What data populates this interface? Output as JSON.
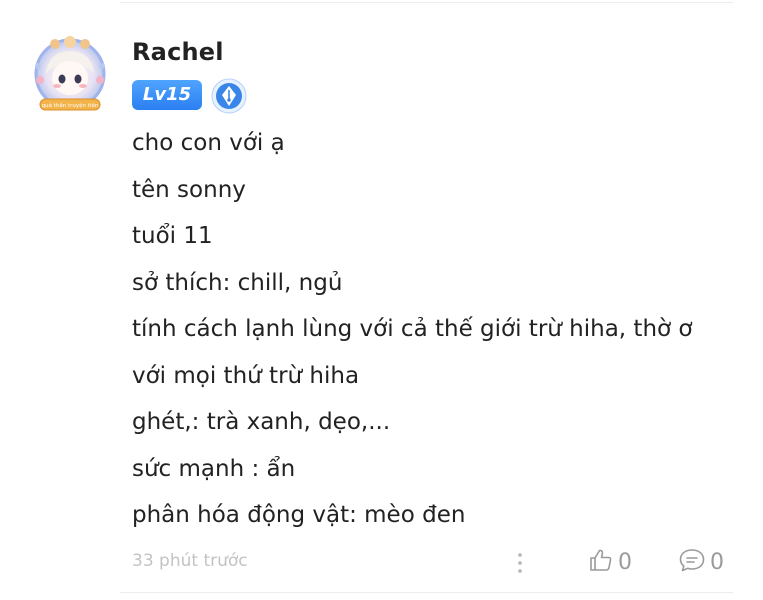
{
  "comment": {
    "username": "Rachel",
    "level": "Lv15",
    "avatar_banner": "quả thần truyện tiên",
    "lines": [
      "cho con với ạ",
      "tên sonny",
      "tuổi 11",
      "sở thích: chill, ngủ",
      "tính cách lạnh lùng với cả thế giới trừ hiha,  thờ ơ",
      "với mọi thứ trừ hiha",
      "ghét,: trà xanh,  dẹo,...",
      "sức mạnh : ẩn",
      "phân hóa động vật: mèo đen"
    ],
    "time": "33 phút trước",
    "likes": "0",
    "replies": "0"
  },
  "icons": {
    "avatar": "anime-avatar-frame",
    "badge": "fountain-pen-badge-icon",
    "more": "more-vertical-icon",
    "like": "thumbs-up-icon",
    "comment": "comment-bubble-icon"
  },
  "colors": {
    "level_badge": "#3a8ef6",
    "pen_badge": "#3a86e8",
    "muted_text": "#c3c3c3",
    "count_text": "#9a9a9a"
  }
}
